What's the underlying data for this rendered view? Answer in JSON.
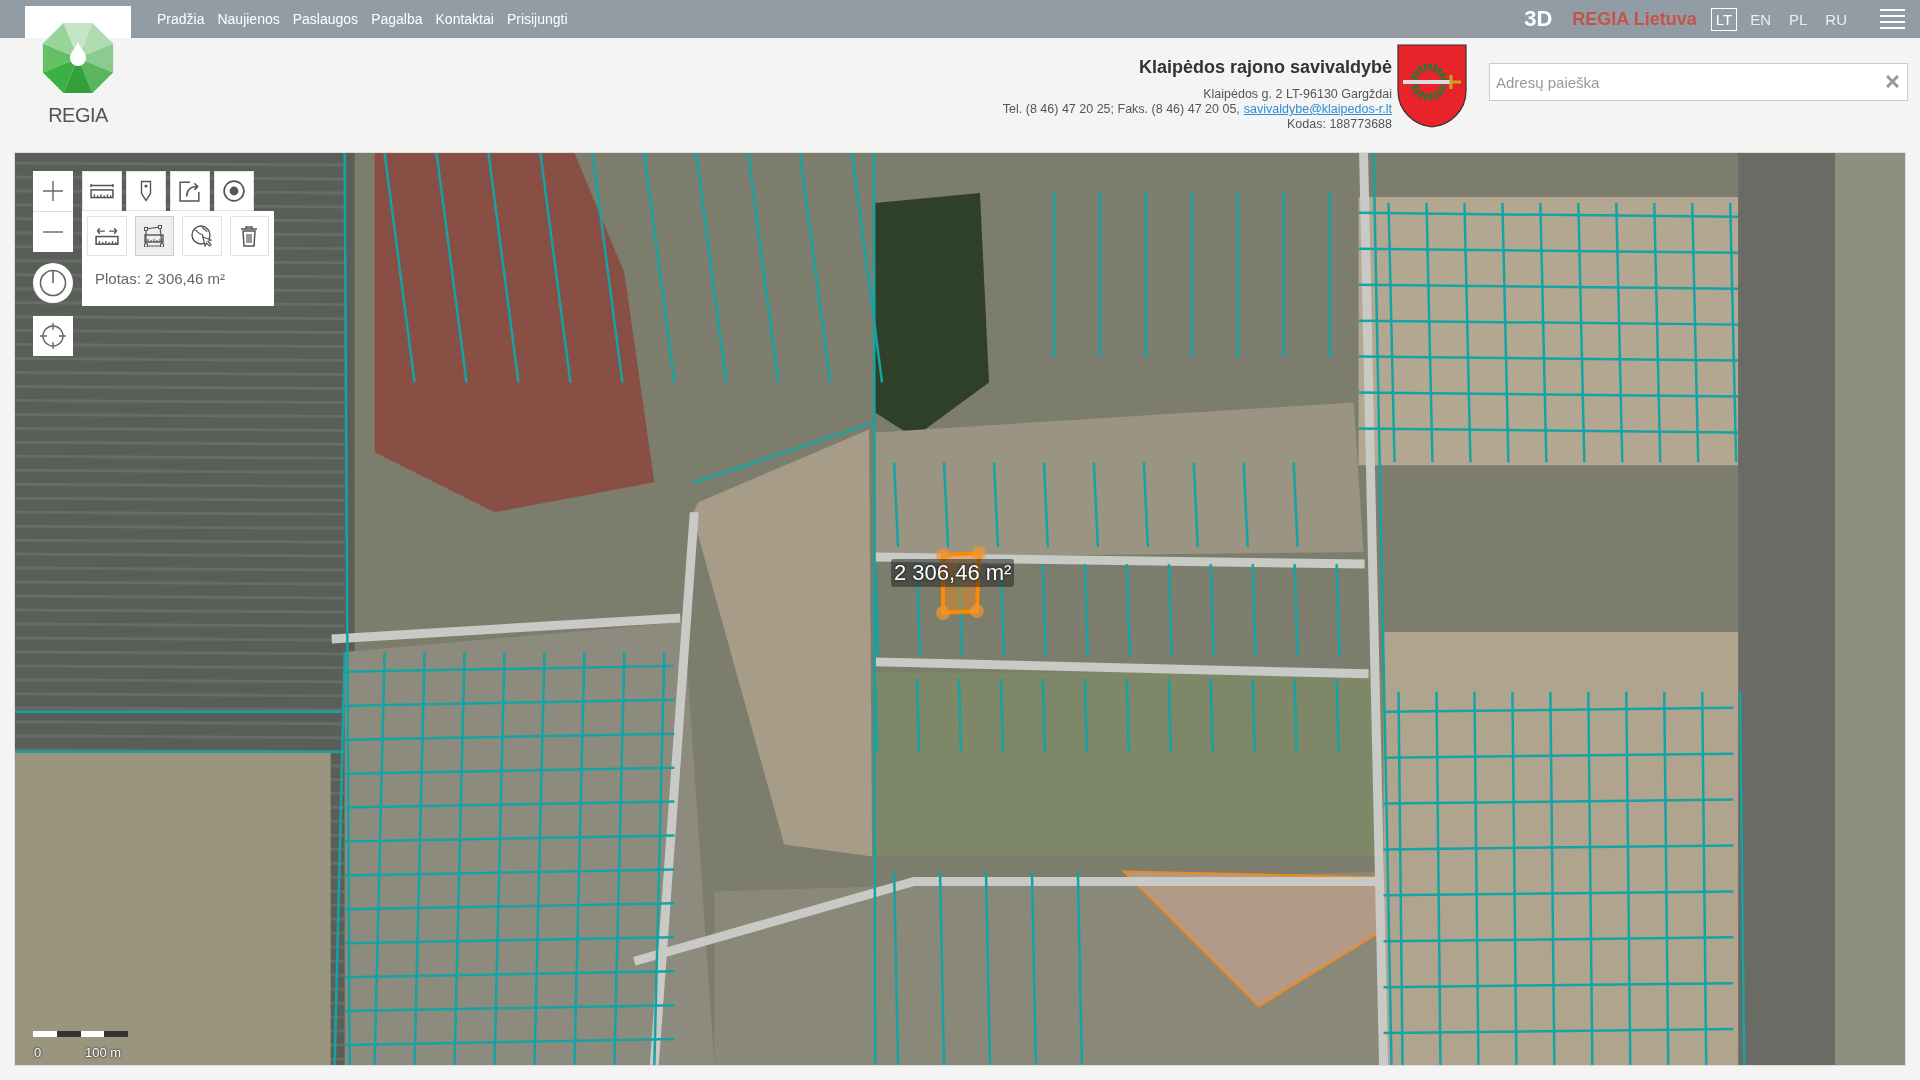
{
  "top_bar": {
    "nav": [
      {
        "label": "Pradžia"
      },
      {
        "label": "Naujienos"
      },
      {
        "label": "Paslaugos"
      },
      {
        "label": "Pagalba"
      },
      {
        "label": "Kontaktai"
      },
      {
        "label": "Prisijungti"
      }
    ],
    "mode": "3D",
    "brand": "REGIA Lietuva",
    "languages": [
      {
        "label": "LT",
        "selected": true
      },
      {
        "label": "EN",
        "selected": false
      },
      {
        "label": "PL",
        "selected": false
      },
      {
        "label": "RU",
        "selected": false
      }
    ]
  },
  "logo": {
    "text": "REGIA"
  },
  "municipality": {
    "name": "Klaipėdos rajono savivaldybė",
    "address": "Klaipėdos g. 2 LT-96130 Gargždai",
    "phone": "Tel. (8 46) 47 20 25; Faks. (8 46) 47 20 05,",
    "email": "savivaldybe@klaipedos-r.lt",
    "code": "Kodas: 188773688"
  },
  "search": {
    "placeholder": "Adresų paieška"
  },
  "map": {
    "tools": [
      {
        "kind": "measure"
      },
      {
        "kind": "pin"
      },
      {
        "kind": "share"
      },
      {
        "kind": "target"
      }
    ],
    "measure_tools": [
      {
        "kind": "distance",
        "selected": false
      },
      {
        "kind": "area",
        "selected": true
      },
      {
        "kind": "globe",
        "selected": false
      },
      {
        "kind": "delete",
        "selected": false
      }
    ],
    "area_readout": "Plotas: 2 306,46 m²",
    "measure_label": "2 306,46 m²",
    "scale": {
      "start": "0",
      "end": "100 m"
    }
  }
}
